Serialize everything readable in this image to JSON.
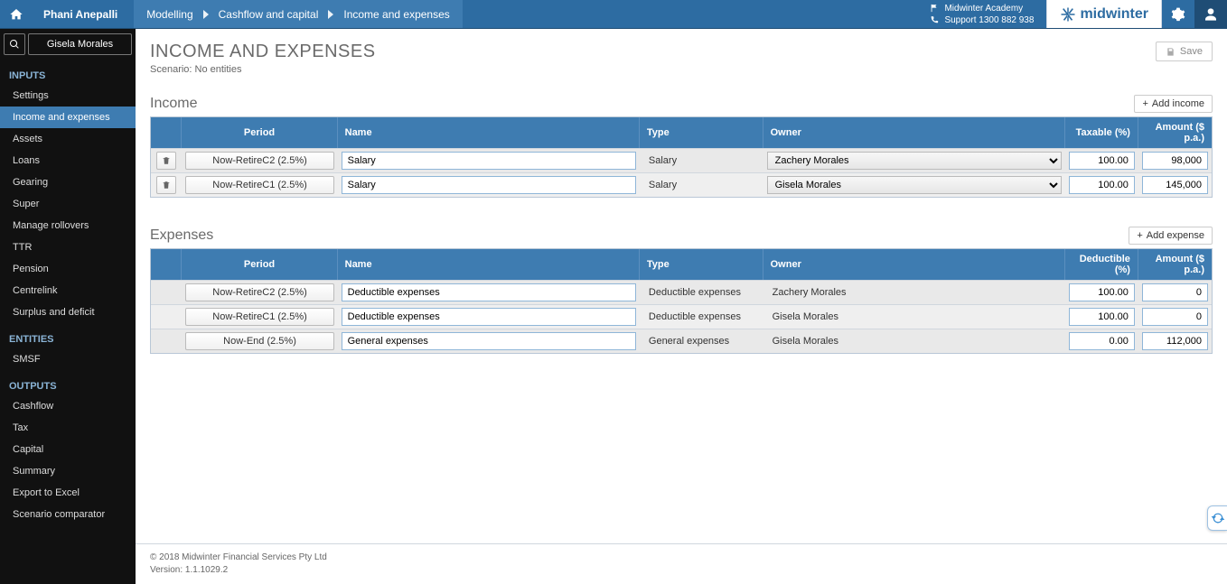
{
  "header": {
    "owner": "Phani Anepalli",
    "breadcrumbs": [
      "Modelling",
      "Cashflow and capital",
      "Income and expenses"
    ],
    "academy": "Midwinter Academy",
    "support": "Support 1300 882 938",
    "brand": "midwinter"
  },
  "sidebar": {
    "client_name": "Gisela Morales",
    "inputs_heading": "INPUTS",
    "inputs": [
      "Settings",
      "Income and expenses",
      "Assets",
      "Loans",
      "Gearing",
      "Super",
      "Manage rollovers",
      "TTR",
      "Pension",
      "Centrelink",
      "Surplus and deficit"
    ],
    "entities_heading": "ENTITIES",
    "entities": [
      "SMSF"
    ],
    "outputs_heading": "OUTPUTS",
    "outputs": [
      "Cashflow",
      "Tax",
      "Capital",
      "Summary",
      "Export to Excel",
      "Scenario comparator"
    ],
    "active": "Income and expenses"
  },
  "page": {
    "title": "INCOME AND EXPENSES",
    "scenario": "Scenario: No entities",
    "save_label": "Save"
  },
  "income": {
    "title": "Income",
    "add_label": "Add income",
    "columns": {
      "period": "Period",
      "name": "Name",
      "type": "Type",
      "owner": "Owner",
      "pct": "Taxable (%)",
      "amt": "Amount ($ p.a.)"
    },
    "rows": [
      {
        "period": "Now-RetireC2 (2.5%)",
        "name": "Salary",
        "type": "Salary",
        "owner": "Zachery Morales",
        "pct": "100.00",
        "amt": "98,000"
      },
      {
        "period": "Now-RetireC1 (2.5%)",
        "name": "Salary",
        "type": "Salary",
        "owner": "Gisela Morales",
        "pct": "100.00",
        "amt": "145,000"
      }
    ]
  },
  "expenses": {
    "title": "Expenses",
    "add_label": "Add expense",
    "columns": {
      "period": "Period",
      "name": "Name",
      "type": "Type",
      "owner": "Owner",
      "pct": "Deductible (%)",
      "amt": "Amount ($ p.a.)"
    },
    "rows": [
      {
        "period": "Now-RetireC2 (2.5%)",
        "name": "Deductible expenses",
        "type": "Deductible expenses",
        "owner": "Zachery Morales",
        "pct": "100.00",
        "amt": "0"
      },
      {
        "period": "Now-RetireC1 (2.5%)",
        "name": "Deductible expenses",
        "type": "Deductible expenses",
        "owner": "Gisela Morales",
        "pct": "100.00",
        "amt": "0"
      },
      {
        "period": "Now-End (2.5%)",
        "name": "General expenses",
        "type": "General expenses",
        "owner": "Gisela Morales",
        "pct": "0.00",
        "amt": "112,000"
      }
    ]
  },
  "footer": {
    "copyright": "© 2018 Midwinter Financial Services Pty Ltd",
    "version": "Version: 1.1.1029.2"
  }
}
